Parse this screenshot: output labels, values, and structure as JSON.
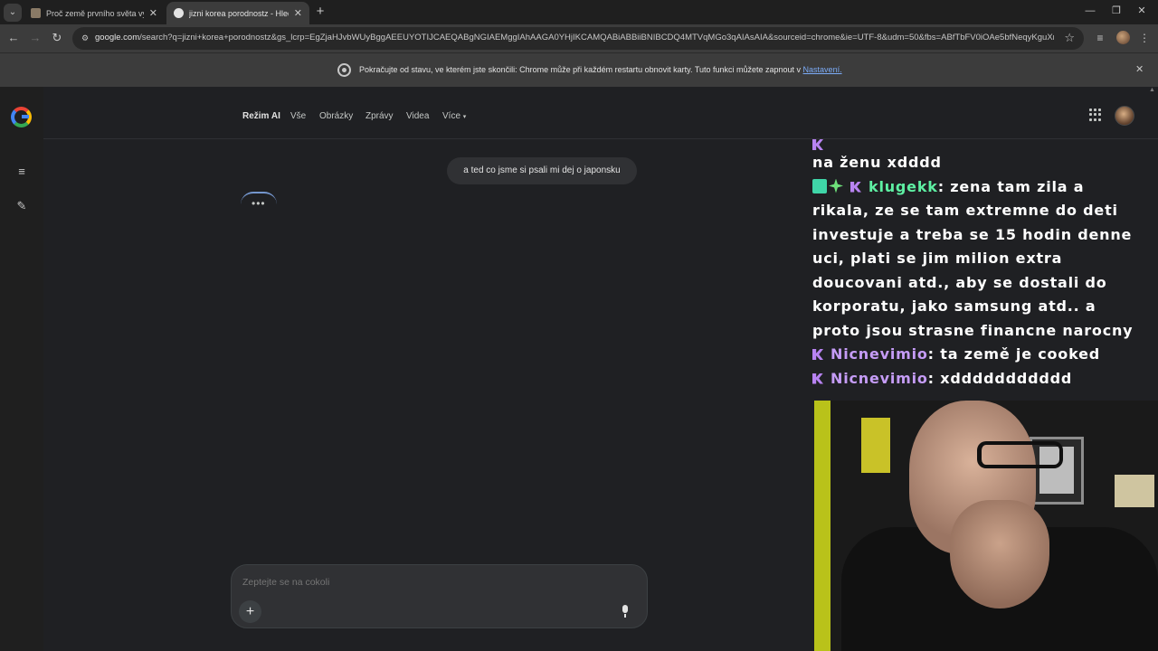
{
  "tabs": [
    {
      "title": "Proč země prvního světa vymíra",
      "active": false
    },
    {
      "title": "jizni korea porodnostz - Hledat",
      "active": true
    }
  ],
  "toolbar": {
    "url_host": "google.com",
    "url_rest": "/search?q=jizni+korea+porodnostz&gs_lcrp=EgZjaHJvbWUyBggAEEUYOTIJCAEQABgNGIAEMggIAhAAGA0YHjIKCAMQABiABBiiBNIBCDQ4MTVqMGo3qAIAsAIA&sourceid=chrome&ie=UTF-8&udm=50&fbs=ABfTbFV0iOAe5bfNeqyKguXm6dMy_0..."
  },
  "infobar": {
    "text": "Pokračujte od stavu, ve kterém jste skončili: Chrome může při každém restartu obnovit karty. Tuto funkci můžete zapnout v ",
    "link": "Nastavení."
  },
  "nav": {
    "items": [
      "Režim AI",
      "Vše",
      "Obrázky",
      "Zprávy",
      "Videa",
      "Více"
    ],
    "active_index": 0
  },
  "conversation": {
    "user_message": "a ted co jsme si psali mi dej o japonsku",
    "loading_dots": "•••"
  },
  "composer": {
    "placeholder": "Zeptejte se na cokoli",
    "plus_label": "+"
  },
  "chat_overlay": {
    "partial_line": "na ženu xdddd",
    "messages": [
      {
        "user": "klugekk",
        "text": "zena tam zila a",
        "color": "#5ef0a3"
      },
      {
        "user": "Nicnevimio",
        "text": "ta země je cooked",
        "color": "#c59cf6"
      },
      {
        "user": "Nicnevimio",
        "text": "xddddddddddd",
        "color": "#c59cf6"
      }
    ],
    "continuation_lines": [
      "rikala, ze se tam extremne do deti",
      "investuje a treba se 15 hodin denne",
      "uci, plati se jim milion extra",
      "doucovani atd., aby se dostali do",
      "korporatu, jako samsung atd.. a",
      "proto jsou strasne financne narocny"
    ]
  },
  "colors": {
    "accent": "#8ab4f8",
    "page_bg": "#1f2023",
    "chrome_bg": "#3c3c3c"
  }
}
